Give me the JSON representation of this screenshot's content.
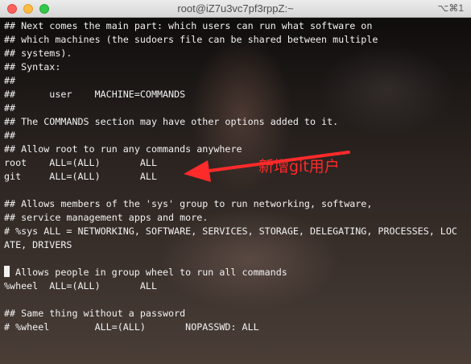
{
  "window": {
    "title": "root@iZ7u3vc7pf3rppZ:~",
    "shortcut": "⌥⌘1"
  },
  "terminal": {
    "lines": [
      "## Next comes the main part: which users can run what software on",
      "## which machines (the sudoers file can be shared between multiple",
      "## systems).",
      "## Syntax:",
      "##",
      "##      user    MACHINE=COMMANDS",
      "##",
      "## The COMMANDS section may have other options added to it.",
      "##",
      "## Allow root to run any commands anywhere",
      "root    ALL=(ALL)       ALL",
      "git     ALL=(ALL)       ALL",
      "",
      "## Allows members of the 'sys' group to run networking, software,",
      "## service management apps and more.",
      "# %sys ALL = NETWORKING, SOFTWARE, SERVICES, STORAGE, DELEGATING, PROCESSES, LOC",
      "ATE, DRIVERS",
      "",
      "# Allows people in group wheel to run all commands",
      "%wheel  ALL=(ALL)       ALL",
      "",
      "## Same thing without a password",
      "# %wheel        ALL=(ALL)       NOPASSWD: ALL"
    ],
    "cursor_line_prefix": "#"
  },
  "annotation": {
    "text": "新增git用户",
    "color": "#ff2a2a"
  },
  "colors": {
    "terminal_text": "#f2f2f2",
    "titlebar": "#e3e3e3"
  }
}
